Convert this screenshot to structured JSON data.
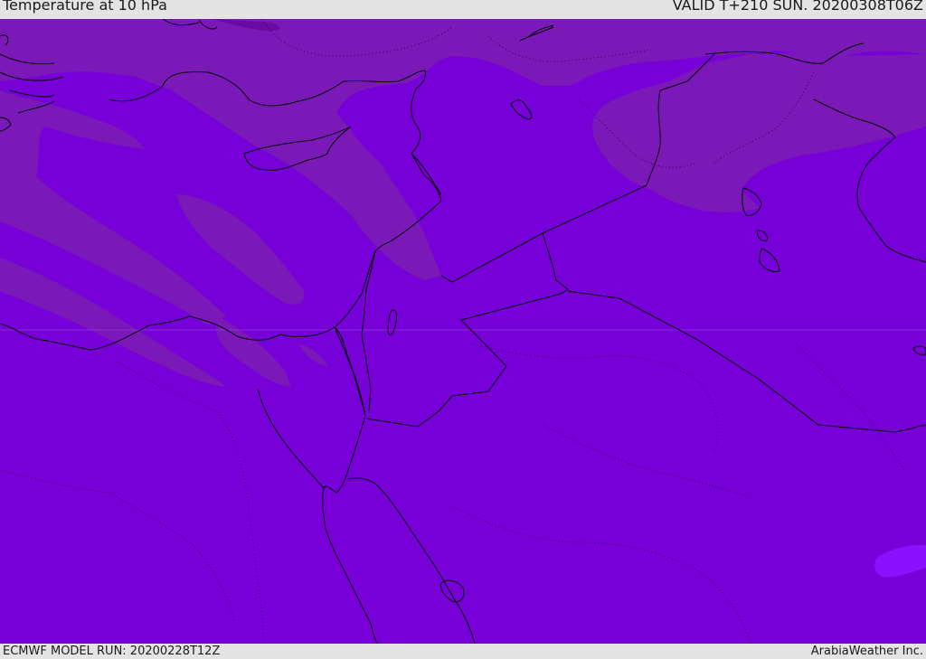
{
  "header": {
    "title": "Temperature at 10 hPa",
    "valid_time": "VALID T+210 SUN. 20200308T06Z"
  },
  "footer": {
    "model_run": "ECMWF MODEL RUN: 20200228T12Z",
    "credit": "ArabiaWeather Inc."
  },
  "map": {
    "colors": {
      "base_field": "#7700d8",
      "warmer_band": "#7a18b8",
      "warmest_core": "#6a0aa0",
      "cold_patch": "#8a10ff",
      "coastline": "#000000"
    },
    "layers": [
      "temperature-field",
      "coastlines",
      "country-borders"
    ]
  }
}
